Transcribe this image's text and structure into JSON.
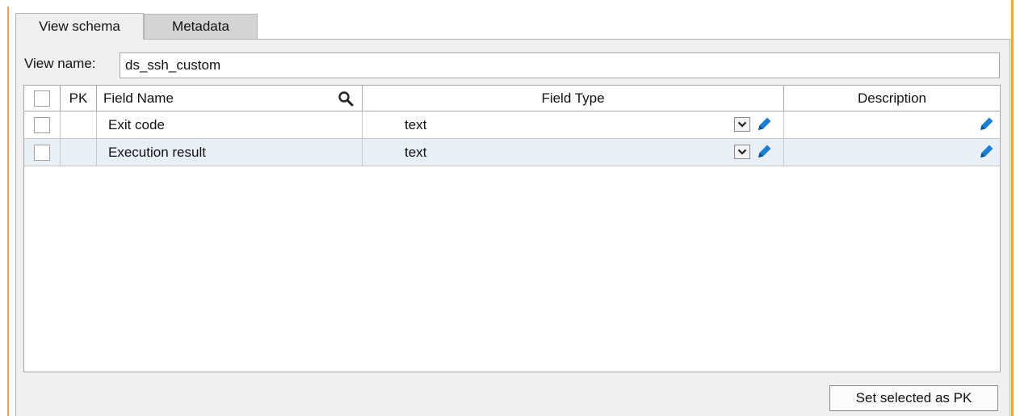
{
  "tabs": [
    {
      "label": "View schema",
      "active": true
    },
    {
      "label": "Metadata",
      "active": false
    }
  ],
  "view_name": {
    "label": "View name:",
    "value": "ds_ssh_custom"
  },
  "table": {
    "columns": {
      "pk": "PK",
      "field_name": "Field Name",
      "field_type": "Field Type",
      "description": "Description"
    },
    "rows": [
      {
        "selected": false,
        "pk": "",
        "field_name": "Exit code",
        "field_type": "text",
        "description": ""
      },
      {
        "selected": false,
        "pk": "",
        "field_name": "Execution result",
        "field_type": "text",
        "description": ""
      }
    ]
  },
  "buttons": {
    "set_pk": "Set selected as PK"
  },
  "icons": {
    "search": "search-icon",
    "edit": "pencil-icon",
    "dropdown": "chevron-down-icon"
  },
  "colors": {
    "accent": "#f0a050",
    "pencil": "#1a7fd6",
    "selected_row": "#e9eff7"
  }
}
